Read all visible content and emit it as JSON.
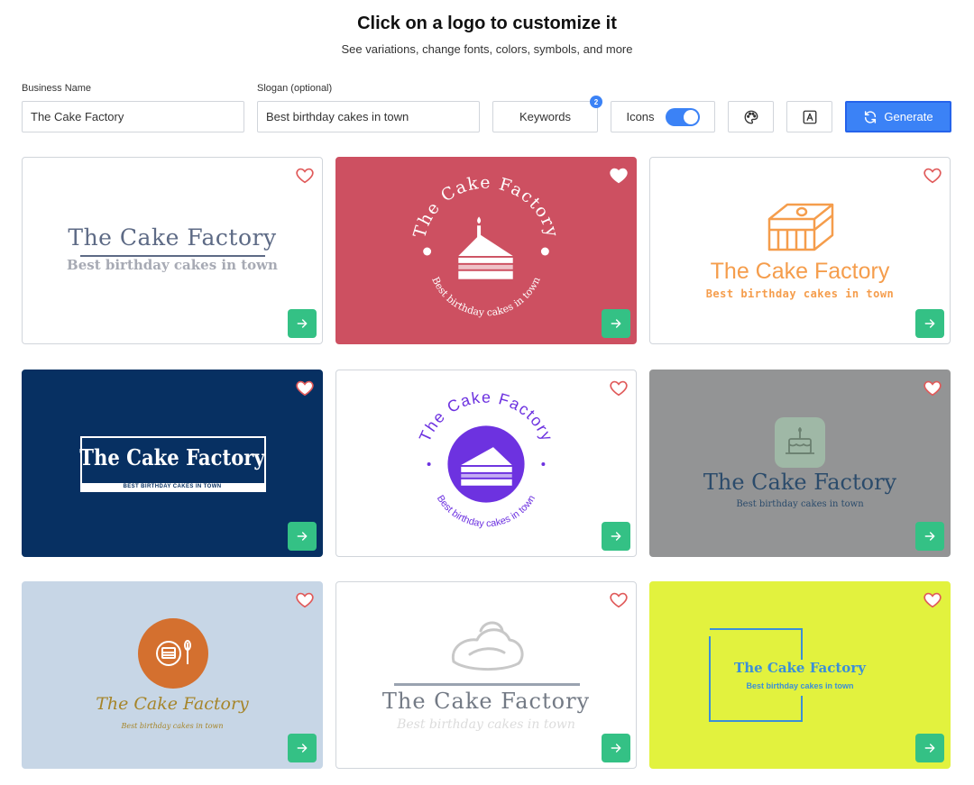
{
  "header": {
    "title": "Click on a logo to customize it",
    "subtitle": "See variations, change fonts, colors, symbols, and more"
  },
  "toolbar": {
    "business_name_label": "Business Name",
    "business_name_value": "The Cake Factory",
    "slogan_label": "Slogan (optional)",
    "slogan_value": "Best birthday cakes in town",
    "keywords_label": "Keywords",
    "keywords_count": "2",
    "icons_label": "Icons",
    "icons_enabled": true,
    "generate_label": "Generate"
  },
  "colors": {
    "accent": "#3b82f6",
    "go_button": "#34c185",
    "heart_stroke": "#e05a5a"
  },
  "logos": [
    {
      "name": "The Cake Factory",
      "slogan": "Best birthday cakes in town",
      "background": "#ffffff",
      "icon": "none"
    },
    {
      "name": "The Cake Factory",
      "slogan": "Best birthday cakes in town",
      "background": "#cd5061",
      "icon": "cake-slice-candle-icon"
    },
    {
      "name": "The Cake Factory",
      "slogan": "Best birthday cakes in town",
      "background": "#ffffff",
      "icon": "cake-box-icon"
    },
    {
      "name": "The Cake Factory",
      "slogan": "BEST BIRTHDAY CAKES IN TOWN",
      "background": "#073062",
      "icon": "none"
    },
    {
      "name": "The Cake Factory",
      "slogan": "Best birthday cakes in town",
      "background": "#ffffff",
      "icon": "cake-slice-icon"
    },
    {
      "name": "The Cake Factory",
      "slogan": "Best birthday cakes in town",
      "background": "#939495",
      "icon": "birthday-cake-icon"
    },
    {
      "name": "The Cake Factory",
      "slogan": "Best birthday cakes in town",
      "background": "#c7d6e6",
      "icon": "cake-plate-icon"
    },
    {
      "name": "The Cake Factory",
      "slogan": "Best birthday cakes in town",
      "background": "#ffffff",
      "icon": "cream-puff-icon"
    },
    {
      "name": "The Cake Factory",
      "slogan": "Best birthday cakes in town",
      "background": "#e2f23e",
      "icon": "square-frame-icon"
    }
  ]
}
